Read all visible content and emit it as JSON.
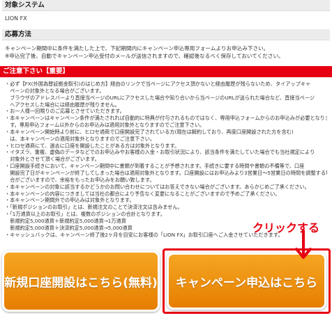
{
  "target_system": {
    "heading": "対象システム",
    "value": "LION FX"
  },
  "how_to_apply": {
    "heading": "応募方法",
    "line1": "キャンペーン期間中に条件を満たした上で、下記期間内にキャンペーン申込専用フォームよりお申込み下さい。",
    "line2": "※申込完了後、自動でキャンペーン申込受付のメールが送信されますので、確認後なるべく保存しておいてください。"
  },
  "notice": {
    "heading": "ご注意下さい【重要】",
    "items": [
      "・必ず【FX(外国為替証拠金取引)のはじめ方】経由のリンクで当ページにアクセス頂かないと経由履歴が残らないため、タイアップキャ",
      "　ペーンの対象外となる場合がございます。",
      "　ブラウザのアドレスバーより直接当ページのURLにアクセスした場合や知り合いから当ページのURLが送られた場合など、直接当ページ",
      "　へアクセスした場合には経由履歴が残りません。",
      "・お一人様一回限りのご応募とさせていただきます。",
      "・本キャンペーンはキャンペーン条件が満たされれば自動的に特典が付与されるものではなく、専用申込フォームからのお申込みが必要となりま",
      "　す。専用申込フォーム以外からのお申込みは適用対象外となりますのでご注意下さい。",
      "・本キャンペーン開始時より前に、ヒロセ通商で口座開設完了されている方(現在は解約しており、再度口座開設された方を含む)",
      "　は、本キャンペーンの適用対象外となりますのでご注意下さい。",
      "・ヒロセ通商にて、過去に口座を開設したことがある方は対象外となります。",
      "・イタズラ、重複、虚偽のデータなどでのお申込みやお客様の入金・お取引状況により、該当条件を満たしていた場合でも当社規定により",
      "　対象外とさせて頂く場合がございます。",
      "・口座開設手続きにおいて、キャンペーン期間中に書類が到着することが予想されます。手続きに要する時間や書類の不備等で、口座",
      "　開設完了日がキャンペーンが終了してしまった場合は適用対象外となります。口座開設にはお申込みより3営業日～5営業日の時間を調整する場",
      "　合がございますので、余裕をもったお申込みをお願い致します。",
      "・本キャンペーンの対象に該当するかどうかのお問い合わせについてはお答えできない場合がございます。あらかじめご了承ください。",
      "・本キャンペーンの内容につきましては当社の都合により予告なく変更になることがございますので予めご了承ください。",
      "・本キャンペーン期間外での申込みは対象外となります。",
      "・「新規ポジションのお取引」とは、新規注文のことで決済注文は含みません。",
      "・「1万通貨以上のお取引」とは、複数のポジションの合計となります。",
      "　新規約定5,000通貨＋新規約定5,000通貨→1万通貨",
      "　新規約定5,000通貨＋決済約定5,000通貨→5,000通貨",
      "・キャッシュバックは、キャンペーン終了後2ヶ月を目安にお客様の「LION FX」お取引口座へご入金させていただきます。"
    ]
  },
  "buttons": {
    "open_account": "新規口座開設はこちら(無料)",
    "apply_campaign": "キャンペーン申込はこちら"
  },
  "annotation": {
    "callout": "クリックする"
  },
  "colors": {
    "accent_red": "#e60012",
    "button_orange": "#f08c00"
  }
}
